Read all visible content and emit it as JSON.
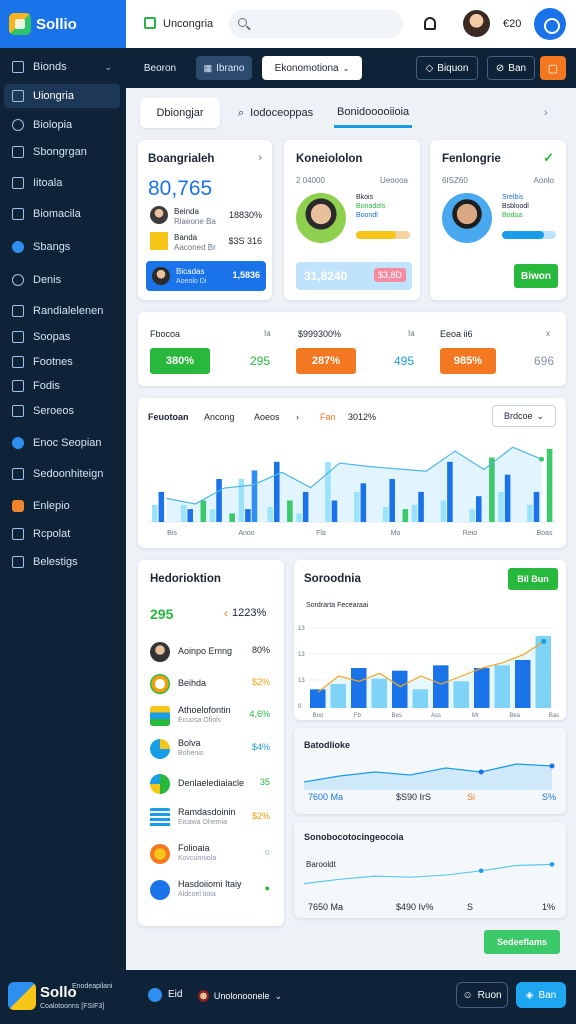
{
  "brand": {
    "name": "Sollio"
  },
  "sidebar": {
    "items": [
      {
        "label": "Bionds",
        "caret": "⌄"
      },
      {
        "label": "Uiongria"
      },
      {
        "label": "Biolopia"
      },
      {
        "label": "Sbongrgan"
      },
      {
        "label": "Iitoala"
      },
      {
        "label": "Biomacila"
      },
      {
        "label": "Sbangs"
      },
      {
        "label": "Denis"
      },
      {
        "label": "Randialelenen"
      },
      {
        "label": "Soopas"
      },
      {
        "label": "Footnes"
      },
      {
        "label": "Fodis"
      },
      {
        "label": "Seroeos"
      },
      {
        "label": "Enoc Seopian"
      },
      {
        "label": "Sedoonhiteign"
      },
      {
        "label": "Enlepio"
      },
      {
        "label": "Rcpolat"
      },
      {
        "label": "Belestigs"
      }
    ]
  },
  "header": {
    "app_title": "Uncongria",
    "count": "€20"
  },
  "toolbar": {
    "plain": "Beoron",
    "ghost": "Ibrano",
    "dropdown": "Ekonomotiona",
    "out1": "Biquon",
    "out2": "Ban"
  },
  "tabs": [
    "Dbiongjar",
    "Iodoceoppas",
    "Bonidooooiioia",
    "›"
  ],
  "card1": {
    "title": "Boangrialeh",
    "chev": "›",
    "big": "80,765",
    "rows": [
      {
        "name": "Beinda",
        "sub": "Rlaeone Ba",
        "value": "18830%"
      },
      {
        "name": "Banda",
        "sub": "Aaconed Br",
        "value": "$3S 316"
      },
      {
        "name": "Bicadas",
        "sub": "Aoeolo Di",
        "value": "1,5836"
      }
    ]
  },
  "card2": {
    "title": "Koneiololon",
    "meta1": "2 04000",
    "meta2": "Ueoooa",
    "lines": [
      "Bkois",
      "Bonadols",
      "Boondl"
    ],
    "pill1": "31,8240",
    "pill2": "$3,8D"
  },
  "card3": {
    "title": "Fenlongrie",
    "meta1": "6ISZ60",
    "meta2": "Aonlo",
    "lines": [
      "Srelbis",
      "Bsbloodl",
      "Bodoa"
    ],
    "button": "Biwon"
  },
  "kpis": [
    {
      "label": "Fbocoa",
      "tag": "Ia",
      "pill": "380%",
      "value": "295",
      "color": "#28b83c"
    },
    {
      "label": "$999300%",
      "tag": "Ia",
      "pill": "287%",
      "value": "495",
      "color": "#f47721"
    },
    {
      "label": "Eeoa ii6",
      "tag": "x",
      "pill": "985%",
      "value": "696",
      "color": "#f47721"
    }
  ],
  "chart1": {
    "labels": [
      "Feuotoan",
      "Ancong",
      "Aoeos",
      "›",
      "Fan",
      "3012%"
    ],
    "dropdown": "Brdcoe",
    "x_ticks": [
      "Bis",
      "Anoo",
      "Fla",
      "Mo",
      "Reio",
      "Boas"
    ]
  },
  "card_list": {
    "title": "Hedorioktion",
    "kpi1": "295",
    "kpi2": "1223%",
    "items": [
      {
        "name": "Aoinpo Emng",
        "sub": "",
        "value": "80%",
        "color": "#222"
      },
      {
        "name": "Beihda",
        "sub": "",
        "value": "$2%",
        "color": "#f59e0b"
      },
      {
        "name": "Athoelofontin",
        "sub": "Ecuosa Ofiols",
        "value": "4,6%",
        "color": "#28b83c"
      },
      {
        "name": "Bolva",
        "sub": "Bohenio",
        "value": "$4%",
        "color": "#1a9de8"
      },
      {
        "name": "Denlaelediaiacle",
        "sub": "",
        "value": "35",
        "color": "#28b83c"
      },
      {
        "name": "Ramdasdoinin",
        "sub": "Eicawa Ohemia",
        "value": "$2%",
        "color": "#f59e0b"
      },
      {
        "name": "Folioaia",
        "sub": "Kovcunniola",
        "value": "○",
        "color": "#28b83c"
      },
      {
        "name": "Hasdoiiomi Itaiy",
        "sub": "Aldcoel tioia",
        "value": "●",
        "color": "#28b83c"
      }
    ]
  },
  "chart2": {
    "title": "Soroodnia",
    "button": "Bil Bun",
    "legend": "Sordrarta Fecearaai",
    "y_ticks": [
      "13",
      "13",
      "13",
      "0"
    ],
    "x_ticks": [
      "Boo",
      "Fb",
      "Bes",
      "Ass",
      "Mr",
      "Bea",
      "Bas"
    ]
  },
  "card_area": {
    "title": "Batodlioke",
    "v1": "7600 Ma",
    "v2": "$S90 IrS",
    "v3": "Si",
    "v4": "S%"
  },
  "card_line": {
    "title": "Sonobocotocingeocoia",
    "sub": "Barooldt",
    "v1": "7650 Ma",
    "v2": "$490 Iv%",
    "v3": "S",
    "v4": "1%"
  },
  "action_button": "Sedeeflams",
  "bottom": {
    "brand": "Sollo",
    "line1": "Enodeapilani",
    "line2": "Coalotoonns [FSIF3]",
    "count": "Eid",
    "user": "Unolonoonele",
    "btn1": "Ruon",
    "btn2": "Ban"
  },
  "colors": {
    "primary": "#1a73e8",
    "sidebar": "#0e2238",
    "green": "#28b83c",
    "orange": "#f47721",
    "cyan": "#9be3fb"
  },
  "chart_data": [
    {
      "type": "bar",
      "ylim": [
        0,
        40
      ],
      "x_ticks": [
        "Bis",
        "Anoo",
        "Fla",
        "Mo",
        "Reio",
        "Boas"
      ],
      "series": [
        {
          "values": [
            8,
            8,
            6,
            20,
            7,
            4,
            28,
            14,
            7,
            8,
            10,
            6,
            14,
            8
          ]
        },
        {
          "values": [
            14,
            6,
            20,
            6,
            28,
            14,
            10,
            18,
            20,
            14,
            28,
            12,
            22,
            14
          ]
        },
        {
          "values": [
            0,
            0,
            0,
            24,
            0,
            0,
            0,
            0,
            0,
            0,
            0,
            0,
            0,
            0
          ]
        },
        {
          "values": [
            0,
            10,
            4,
            0,
            10,
            0,
            0,
            0,
            6,
            0,
            0,
            30,
            0,
            34
          ]
        }
      ]
    },
    {
      "type": "bar",
      "ylim": [
        0,
        30
      ],
      "x_ticks": [
        "Boo",
        "Fb",
        "Bes",
        "Ass",
        "Mr",
        "Bea",
        "Bas"
      ],
      "series": [
        {
          "values": [
            7,
            9,
            15,
            11,
            14,
            7,
            16,
            10,
            15,
            16,
            18,
            27
          ]
        },
        {
          "values": [
            6,
            12,
            10,
            13,
            8,
            12,
            9,
            12,
            15,
            17,
            20,
            25
          ]
        }
      ]
    },
    {
      "type": "area",
      "values": [
        8,
        14,
        18,
        15,
        22,
        18,
        26,
        24
      ]
    },
    {
      "type": "line",
      "values": [
        6,
        10,
        13,
        12,
        14,
        18,
        23,
        24
      ]
    }
  ]
}
